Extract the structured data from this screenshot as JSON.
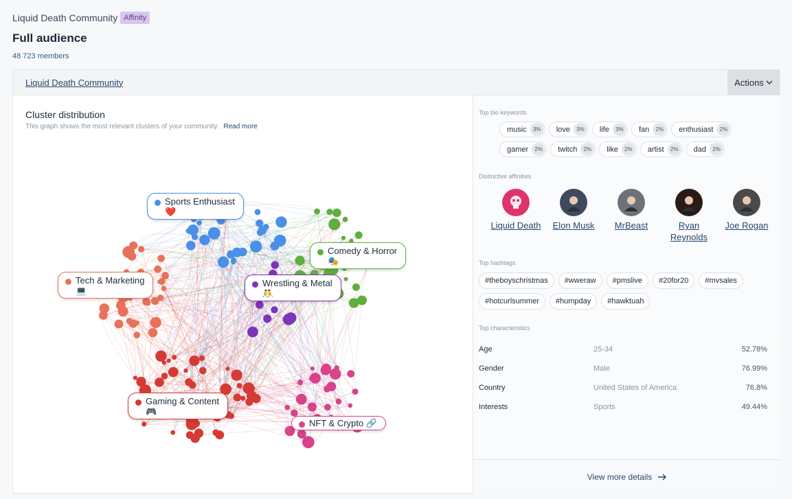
{
  "header": {
    "breadcrumb": "Liquid Death Community",
    "badge": "Affinity",
    "title": "Full audience",
    "members": "48 723 members"
  },
  "card": {
    "title": "Liquid Death Community",
    "actions_label": "Actions"
  },
  "cluster": {
    "title": "Cluster distribution",
    "subtitle": "This graph shows the most relevant clusters of your community.",
    "read_more": "Read more",
    "clusters": [
      {
        "name": "Sports Enthusiast",
        "emoji": "❤️",
        "color": "#4a8fe8"
      },
      {
        "name": "Comedy & Horror",
        "emoji": "🎭",
        "color": "#5fae3f"
      },
      {
        "name": "Tech & Marketing",
        "emoji": "💻",
        "color": "#e8715a"
      },
      {
        "name": "Wrestling & Metal",
        "emoji": "🤼",
        "color": "#7b35b8"
      },
      {
        "name": "Gaming & Content",
        "emoji": "🎮",
        "color": "#d63a34"
      },
      {
        "name": "NFT & Crypto 🔗",
        "emoji": "",
        "color": "#d8438a"
      }
    ]
  },
  "bio_keywords": {
    "title": "Top bio keywords",
    "items": [
      {
        "word": "music",
        "pct": "3%"
      },
      {
        "word": "love",
        "pct": "3%"
      },
      {
        "word": "life",
        "pct": "3%"
      },
      {
        "word": "fan",
        "pct": "2%"
      },
      {
        "word": "enthusiast",
        "pct": "2%"
      },
      {
        "word": "gamer",
        "pct": "2%"
      },
      {
        "word": "twitch",
        "pct": "2%"
      },
      {
        "word": "like",
        "pct": "2%"
      },
      {
        "word": "artist",
        "pct": "2%"
      },
      {
        "word": "dad",
        "pct": "2%"
      }
    ]
  },
  "affinities": {
    "title": "Distinctive affinities",
    "items": [
      {
        "name": "Liquid Death",
        "icon": "skull-logo-icon",
        "color": "#e0336b"
      },
      {
        "name": "Elon Musk",
        "icon": "avatar-icon",
        "color": "#3d4a5e"
      },
      {
        "name": "MrBeast",
        "icon": "avatar-icon",
        "color": "#6e7278"
      },
      {
        "name": "Ryan Reynolds",
        "icon": "avatar-icon",
        "color": "#2b1a18"
      },
      {
        "name": "Joe Rogan",
        "icon": "avatar-icon",
        "color": "#4a4a4a"
      }
    ]
  },
  "hashtags": {
    "title": "Top hashtags",
    "items": [
      "#theboyschristmas",
      "#wweraw",
      "#pmslive",
      "#20for20",
      "#mvsales",
      "#hotcurlsummer",
      "#humpday",
      "#hawktuah"
    ]
  },
  "characteristics": {
    "title": "Top characteristics",
    "rows": [
      {
        "key": "Age",
        "value": "25-34",
        "pct": "52.78%"
      },
      {
        "key": "Gender",
        "value": "Male",
        "pct": "76.99%"
      },
      {
        "key": "Country",
        "value": "United States of America",
        "pct": "76.8%"
      },
      {
        "key": "Interests",
        "value": "Sports",
        "pct": "49.44%"
      }
    ]
  },
  "view_more": "View more details"
}
